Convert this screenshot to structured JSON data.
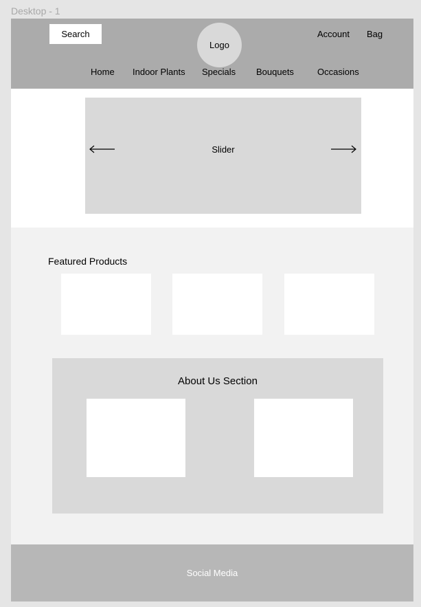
{
  "frame": {
    "label": "Desktop - 1"
  },
  "header": {
    "search_label": "Search",
    "logo_label": "Logo",
    "account_label": "Account",
    "bag_label": "Bag",
    "nav": [
      "Home",
      "Indoor Plants",
      "Specials",
      "Bouquets",
      "Occasions"
    ]
  },
  "hero": {
    "slider_label": "Slider"
  },
  "featured": {
    "title": "Featured Products"
  },
  "about": {
    "title": "About Us Section"
  },
  "footer": {
    "label": "Social Media"
  }
}
